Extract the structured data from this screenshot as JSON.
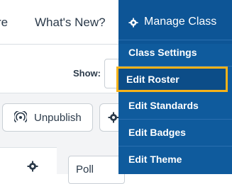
{
  "nav": {
    "partial_label": "re",
    "whats_new_label": "What's New?"
  },
  "toolbar": {
    "show_label": "Show:",
    "unpublish_label": "Unpublish"
  },
  "content": {
    "poll_label": "Poll"
  },
  "manage_class": {
    "title": "Manage Class",
    "items": [
      {
        "label": "Class Settings"
      },
      {
        "label": "Edit Roster"
      },
      {
        "label": "Edit Standards"
      },
      {
        "label": "Edit Badges"
      },
      {
        "label": "Edit Theme"
      }
    ]
  },
  "colors": {
    "dropdown_bg": "#0f5b9d",
    "highlight_border": "#f5b21a"
  },
  "icons": [
    "gear-icon",
    "broadcast-icon"
  ]
}
